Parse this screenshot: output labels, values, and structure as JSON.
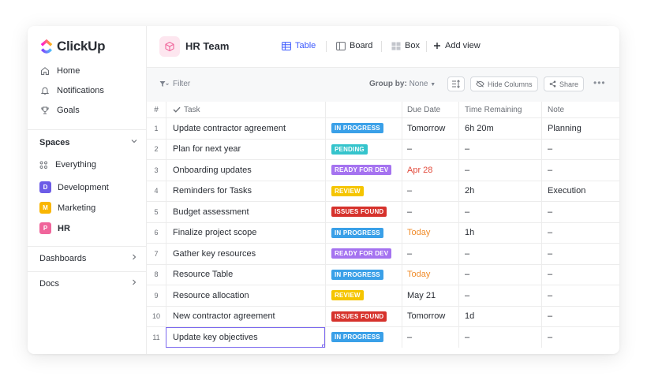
{
  "brand": {
    "name": "ClickUp"
  },
  "sidebar": {
    "nav": [
      {
        "label": "Home",
        "icon": "home-icon"
      },
      {
        "label": "Notifications",
        "icon": "bell-icon"
      },
      {
        "label": "Goals",
        "icon": "trophy-icon"
      }
    ],
    "spaces_label": "Spaces",
    "spaces": [
      {
        "label": "Everything",
        "badge": "",
        "color": ""
      },
      {
        "label": "Development",
        "badge": "D",
        "color": "#6c5ce7"
      },
      {
        "label": "Marketing",
        "badge": "M",
        "color": "#f9b602"
      },
      {
        "label": "HR",
        "badge": "P",
        "color": "#f0659b"
      }
    ],
    "dashboards_label": "Dashboards",
    "docs_label": "Docs"
  },
  "header": {
    "team_name": "HR Team",
    "views": [
      "Table",
      "Board",
      "Box"
    ],
    "add_view": "Add view"
  },
  "toolbar": {
    "filter": "Filter",
    "group_by_label": "Group by:",
    "group_by_value": "None",
    "hide_columns": "Hide Columns",
    "share": "Share"
  },
  "table": {
    "columns": {
      "num": "#",
      "task": "Task",
      "status": "",
      "due": "Due Date",
      "time": "Time Remaining",
      "note": "Note"
    },
    "status_colors": {
      "IN PROGRESS": "#3aa0e8",
      "PENDING": "#35c4cc",
      "READY FOR DEV": "#a573f0",
      "REVIEW": "#f5c500",
      "ISSUES FOUND": "#d6322c"
    },
    "due_colors": {
      "red": "#e24a3b",
      "orange": "#f08c2b"
    },
    "rows": [
      {
        "num": "1",
        "task": "Update contractor agreement",
        "status": "IN PROGRESS",
        "due": "Tomorrow",
        "due_color": "",
        "time": "6h 20m",
        "note": "Planning"
      },
      {
        "num": "2",
        "task": "Plan for next year",
        "status": "PENDING",
        "due": "–",
        "due_color": "",
        "time": "–",
        "note": "–"
      },
      {
        "num": "3",
        "task": "Onboarding updates",
        "status": "READY FOR DEV",
        "due": "Apr 28",
        "due_color": "red",
        "time": "–",
        "note": "–"
      },
      {
        "num": "4",
        "task": "Reminders for Tasks",
        "status": "REVIEW",
        "due": "–",
        "due_color": "",
        "time": "2h",
        "note": "Execution"
      },
      {
        "num": "5",
        "task": "Budget assessment",
        "status": "ISSUES FOUND",
        "due": "–",
        "due_color": "",
        "time": "–",
        "note": "–"
      },
      {
        "num": "6",
        "task": "Finalize project scope",
        "status": "IN PROGRESS",
        "due": "Today",
        "due_color": "orange",
        "time": "1h",
        "note": "–"
      },
      {
        "num": "7",
        "task": "Gather key resources",
        "status": "READY FOR DEV",
        "due": "–",
        "due_color": "",
        "time": "–",
        "note": "–"
      },
      {
        "num": "8",
        "task": "Resource Table",
        "status": "IN PROGRESS",
        "due": "Today",
        "due_color": "orange",
        "time": "–",
        "note": "–"
      },
      {
        "num": "9",
        "task": "Resource allocation",
        "status": "REVIEW",
        "due": "May 21",
        "due_color": "",
        "time": "–",
        "note": "–"
      },
      {
        "num": "10",
        "task": "New contractor agreement",
        "status": "ISSUES FOUND",
        "due": "Tomorrow",
        "due_color": "",
        "time": "1d",
        "note": "–"
      },
      {
        "num": "11",
        "task": "Update key objectives",
        "status": "IN PROGRESS",
        "due": "–",
        "due_color": "",
        "time": "–",
        "note": "–"
      }
    ]
  }
}
